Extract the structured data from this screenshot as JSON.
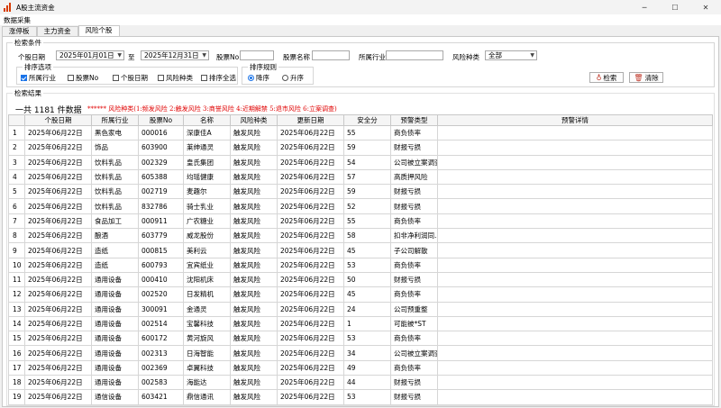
{
  "window": {
    "title": "A股主流资金",
    "minimize": "─",
    "maximize": "☐",
    "close": "✕",
    "icon": "bar-chart-icon"
  },
  "menu": {
    "label": "数据采集"
  },
  "tabs": [
    "涨停板",
    "主力资金",
    "风险个股"
  ],
  "search": {
    "group_title": "检索条件",
    "date_label": "个股日期",
    "date_from": "2025年01月01日",
    "to_label": "至",
    "date_to": "2025年12月31日",
    "code_label": "股票No",
    "code_value": "",
    "name_label": "股票名称",
    "name_value": "",
    "industry_label": "所属行业",
    "industry_value": "",
    "risk_label": "风险种类",
    "risk_value": "全部",
    "sort_options_title": "排序选项",
    "sort_options": [
      {
        "label": "所属行业",
        "checked": true
      },
      {
        "label": "股票No",
        "checked": false
      },
      {
        "label": "个股日期",
        "checked": false
      },
      {
        "label": "风险种类",
        "checked": false
      },
      {
        "label": "排序全选",
        "checked": false
      }
    ],
    "sort_rule_title": "排序规则",
    "sort_rules": [
      {
        "label": "降序",
        "checked": true
      },
      {
        "label": "升序",
        "checked": false
      }
    ],
    "search_button": "检索",
    "clear_button": "清除"
  },
  "results": {
    "group_title": "检索结果",
    "count_text": "一共 1181 件数据",
    "legend": "****** 风险种类(1:频发风险 2:触发风险 3:商誉风险 4:近期解禁 5:退市风险 6:立案调查)",
    "columns": [
      "",
      "个股日期",
      "所属行业",
      "股票No",
      "名称",
      "风险种类",
      "更新日期",
      "安全分",
      "预警类型",
      "预警详情"
    ],
    "rows": [
      [
        "1",
        "2025年06月22日",
        "黑色家电",
        "000016",
        "深康佳A",
        "触发风险",
        "2025年06月22日",
        "55",
        "商负债率",
        ""
      ],
      [
        "2",
        "2025年06月22日",
        "饰品",
        "603900",
        "莱绅通灵",
        "触发风险",
        "2025年06月22日",
        "59",
        "财报亏损",
        ""
      ],
      [
        "3",
        "2025年06月22日",
        "饮料乳品",
        "002329",
        "皇氏集团",
        "触发风险",
        "2025年06月22日",
        "54",
        "公司被立案调查",
        ""
      ],
      [
        "4",
        "2025年06月22日",
        "饮料乳品",
        "605388",
        "均瑶健康",
        "触发风险",
        "2025年06月22日",
        "57",
        "高质押风险",
        ""
      ],
      [
        "5",
        "2025年06月22日",
        "饮料乳品",
        "002719",
        "麦趣尔",
        "触发风险",
        "2025年06月22日",
        "59",
        "财报亏损",
        ""
      ],
      [
        "6",
        "2025年06月22日",
        "饮料乳品",
        "832786",
        "骑士乳业",
        "触发风险",
        "2025年06月22日",
        "52",
        "财报亏损",
        ""
      ],
      [
        "7",
        "2025年06月22日",
        "食品加工",
        "000911",
        "广农糖业",
        "触发风险",
        "2025年06月22日",
        "55",
        "商负债率",
        ""
      ],
      [
        "8",
        "2025年06月22日",
        "酿酒",
        "603779",
        "威龙股份",
        "触发风险",
        "2025年06月22日",
        "58",
        "扣非净利润同...",
        ""
      ],
      [
        "9",
        "2025年06月22日",
        "造纸",
        "000815",
        "美利云",
        "触发风险",
        "2025年06月22日",
        "45",
        "子公司解散",
        ""
      ],
      [
        "10",
        "2025年06月22日",
        "造纸",
        "600793",
        "宜宾纸业",
        "触发风险",
        "2025年06月22日",
        "53",
        "商负债率",
        ""
      ],
      [
        "11",
        "2025年06月22日",
        "通用设备",
        "000410",
        "沈阳机床",
        "触发风险",
        "2025年06月22日",
        "50",
        "财报亏损",
        ""
      ],
      [
        "12",
        "2025年06月22日",
        "通用设备",
        "002520",
        "日发精机",
        "触发风险",
        "2025年06月22日",
        "45",
        "商负债率",
        ""
      ],
      [
        "13",
        "2025年06月22日",
        "通用设备",
        "300091",
        "金通灵",
        "触发风险",
        "2025年06月22日",
        "24",
        "公司预重整",
        ""
      ],
      [
        "14",
        "2025年06月22日",
        "通用设备",
        "002514",
        "宝馨科技",
        "触发风险",
        "2025年06月22日",
        "1",
        "可能被*ST",
        ""
      ],
      [
        "15",
        "2025年06月22日",
        "通用设备",
        "600172",
        "黄河旋风",
        "触发风险",
        "2025年06月22日",
        "53",
        "商负债率",
        ""
      ],
      [
        "16",
        "2025年06月22日",
        "通用设备",
        "002313",
        "日海智能",
        "触发风险",
        "2025年06月22日",
        "34",
        "公司被立案调查",
        ""
      ],
      [
        "17",
        "2025年06月22日",
        "通用设备",
        "002369",
        "卓翼科技",
        "触发风险",
        "2025年06月22日",
        "49",
        "商负债率",
        ""
      ],
      [
        "18",
        "2025年06月22日",
        "通用设备",
        "002583",
        "海能达",
        "触发风险",
        "2025年06月22日",
        "44",
        "财报亏损",
        ""
      ],
      [
        "19",
        "2025年06月22日",
        "通信设备",
        "603421",
        "鼎信通讯",
        "触发风险",
        "2025年06月22日",
        "53",
        "财报亏损",
        ""
      ]
    ]
  }
}
